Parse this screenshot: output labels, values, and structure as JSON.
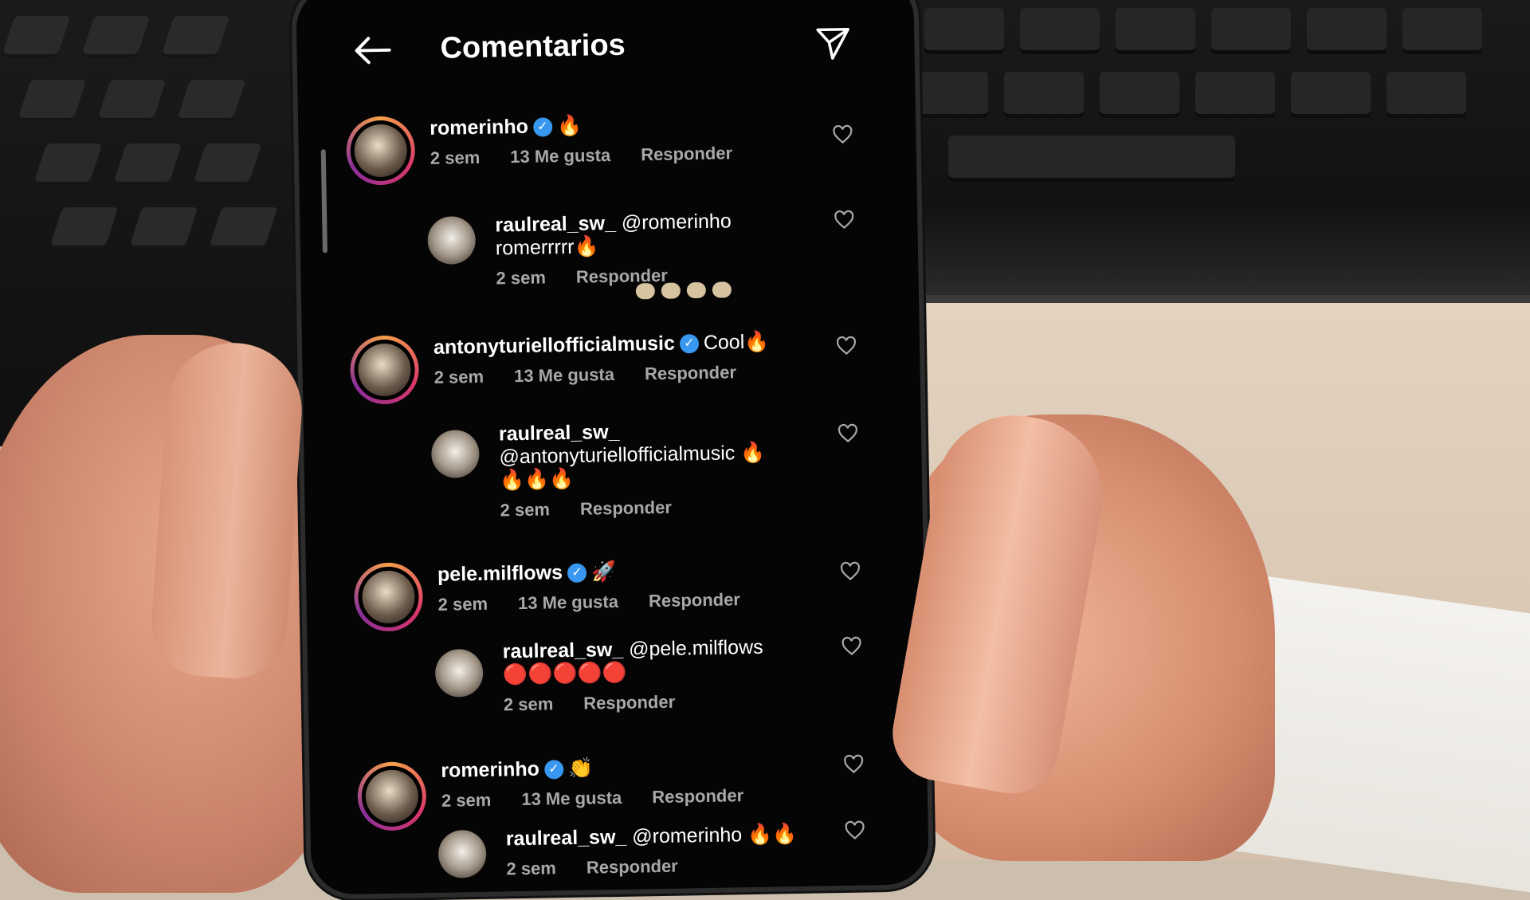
{
  "header": {
    "title": "Comentarios"
  },
  "comments": [
    {
      "user": "romerinho",
      "verified": true,
      "text": "🔥",
      "time": "2 sem",
      "likes": "13 Me gusta",
      "reply": "Responder"
    },
    {
      "user": "raulreal_sw_",
      "verified": false,
      "text": "@romerinho romerrrrr🔥",
      "time": "2 sem",
      "reply": "Responder"
    },
    {
      "user": "antonyturiellofficialmusic",
      "verified": true,
      "text": "Cool🔥",
      "time": "2 sem",
      "likes": "13 Me gusta",
      "reply": "Responder"
    },
    {
      "user": "raulreal_sw_",
      "verified": false,
      "text": "@antonyturiellofficialmusic 🔥🔥🔥🔥",
      "time": "2 sem",
      "reply": "Responder"
    },
    {
      "user": "pele.milflows",
      "verified": true,
      "text": "🚀",
      "time": "2 sem",
      "likes": "13 Me gusta",
      "reply": "Responder"
    },
    {
      "user": "raulreal_sw_",
      "verified": false,
      "text": "@pele.milflows 🔴🔴🔴🔴🔴",
      "time": "2 sem",
      "reply": "Responder"
    },
    {
      "user": "romerinho",
      "verified": true,
      "text": "👏",
      "time": "2 sem",
      "likes": "13 Me gusta",
      "reply": "Responder"
    },
    {
      "user": "raulreal_sw_",
      "verified": false,
      "text": "@romerinho 🔥🔥",
      "time": "2 sem",
      "reply": "Responder"
    }
  ],
  "colors": {
    "background": "#000000",
    "verified": "#3897f0",
    "meta": "#a8a8a8"
  },
  "icons": {
    "back": "arrow-left-icon",
    "send": "send-icon",
    "like": "heart-icon"
  }
}
